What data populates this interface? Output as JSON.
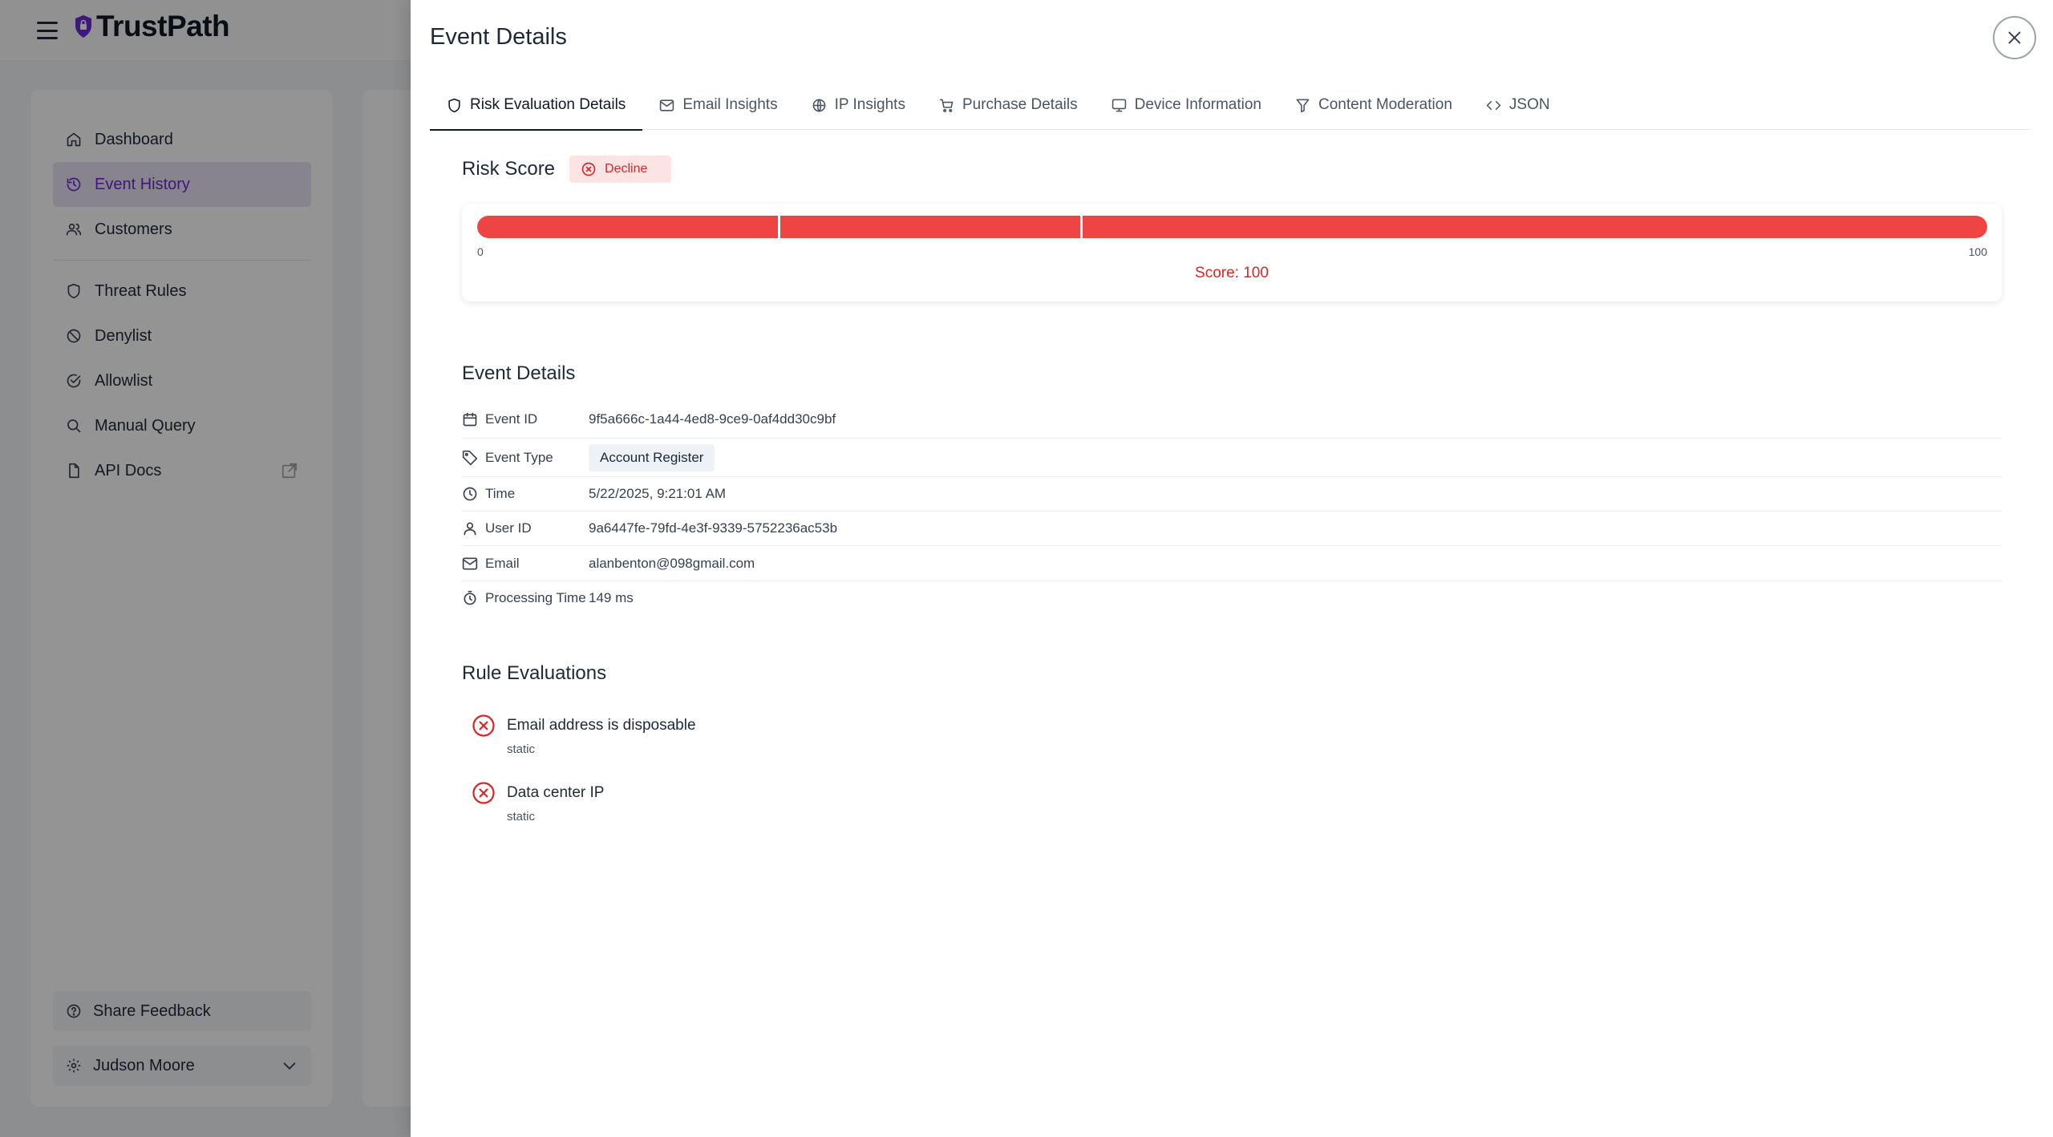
{
  "app": {
    "brand_name": "TrustPath",
    "nav": [
      {
        "label": "Dashboard",
        "icon": "home-icon"
      },
      {
        "label": "Event History",
        "icon": "history-icon",
        "active": true
      },
      {
        "label": "Customers",
        "icon": "users-icon"
      },
      {
        "label": "Threat Rules",
        "icon": "shield-icon"
      },
      {
        "label": "Denylist",
        "icon": "ban-icon"
      },
      {
        "label": "Allowlist",
        "icon": "check-circle-icon"
      },
      {
        "label": "Manual Query",
        "icon": "search-icon"
      },
      {
        "label": "API Docs",
        "icon": "file-icon",
        "external": true
      }
    ],
    "share_feedback_label": "Share Feedback",
    "user_name": "Judson Moore"
  },
  "drawer": {
    "title": "Event Details",
    "tabs": [
      {
        "label": "Risk Evaluation Details",
        "icon": "shield-icon",
        "active": true
      },
      {
        "label": "Email Insights",
        "icon": "mail-icon"
      },
      {
        "label": "IP Insights",
        "icon": "globe-icon"
      },
      {
        "label": "Purchase Details",
        "icon": "cart-icon"
      },
      {
        "label": "Device Information",
        "icon": "monitor-icon"
      },
      {
        "label": "Content Moderation",
        "icon": "filter-icon"
      },
      {
        "label": "JSON",
        "icon": "code-icon"
      }
    ],
    "risk": {
      "title": "Risk Score",
      "decision": "Decline",
      "min_label": "0",
      "max_label": "100",
      "score_text": "Score: 100",
      "score": 100,
      "max": 100,
      "bar_color": "#ef4444",
      "decision_color": "#dc2626"
    },
    "event_details": {
      "title": "Event Details",
      "rows": [
        {
          "label": "Event ID",
          "value": "9f5a666c-1a44-4ed8-9ce9-0af4dd30c9bf",
          "icon": "calendar-icon"
        },
        {
          "label": "Event Type",
          "value": "Account Register",
          "icon": "tag-icon",
          "chip": true
        },
        {
          "label": "Time",
          "value": "5/22/2025, 9:21:01 AM",
          "icon": "clock-icon"
        },
        {
          "label": "User ID",
          "value": "9a6447fe-79fd-4e3f-9339-5752236ac53b",
          "icon": "user-icon"
        },
        {
          "label": "Email",
          "value": "alanbenton@098gmail.com",
          "icon": "mail-icon"
        },
        {
          "label": "Processing Time",
          "value": "149 ms",
          "icon": "timer-icon"
        }
      ]
    },
    "rule_evaluations": {
      "title": "Rule Evaluations",
      "rules": [
        {
          "name": "Email address is disposable",
          "type": "static",
          "icon": "x-circle-icon"
        },
        {
          "name": "Data center IP",
          "type": "static",
          "icon": "x-circle-icon"
        }
      ]
    }
  }
}
